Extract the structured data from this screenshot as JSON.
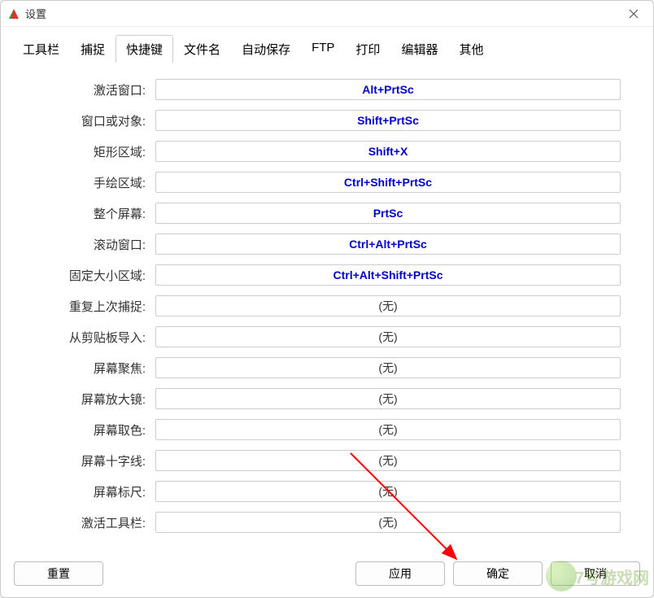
{
  "window": {
    "title": "设置"
  },
  "tabs": {
    "items": [
      {
        "label": "工具栏"
      },
      {
        "label": "捕捉"
      },
      {
        "label": "快捷键"
      },
      {
        "label": "文件名"
      },
      {
        "label": "自动保存"
      },
      {
        "label": "FTP"
      },
      {
        "label": "打印"
      },
      {
        "label": "编辑器"
      },
      {
        "label": "其他"
      }
    ],
    "activeIndex": 2
  },
  "shortcuts": [
    {
      "label": "激活窗口:",
      "value": "Alt+PrtSc",
      "has_value": true
    },
    {
      "label": "窗口或对象:",
      "value": "Shift+PrtSc",
      "has_value": true
    },
    {
      "label": "矩形区域:",
      "value": "Shift+X",
      "has_value": true
    },
    {
      "label": "手绘区域:",
      "value": "Ctrl+Shift+PrtSc",
      "has_value": true
    },
    {
      "label": "整个屏幕:",
      "value": "PrtSc",
      "has_value": true
    },
    {
      "label": "滚动窗口:",
      "value": "Ctrl+Alt+PrtSc",
      "has_value": true
    },
    {
      "label": "固定大小区域:",
      "value": "Ctrl+Alt+Shift+PrtSc",
      "has_value": true
    },
    {
      "label": "重复上次捕捉:",
      "value": "(无)",
      "has_value": false
    },
    {
      "label": "从剪贴板导入:",
      "value": "(无)",
      "has_value": false
    },
    {
      "label": "屏幕聚焦:",
      "value": "(无)",
      "has_value": false
    },
    {
      "label": "屏幕放大镜:",
      "value": "(无)",
      "has_value": false
    },
    {
      "label": "屏幕取色:",
      "value": "(无)",
      "has_value": false
    },
    {
      "label": "屏幕十字线:",
      "value": "(无)",
      "has_value": false
    },
    {
      "label": "屏幕标尺:",
      "value": "(无)",
      "has_value": false
    },
    {
      "label": "激活工具栏:",
      "value": "(无)",
      "has_value": false
    }
  ],
  "buttons": {
    "reset": "重置",
    "apply": "应用",
    "ok": "确定",
    "cancel": "取消"
  },
  "watermark": {
    "text": "7号游戏网"
  }
}
